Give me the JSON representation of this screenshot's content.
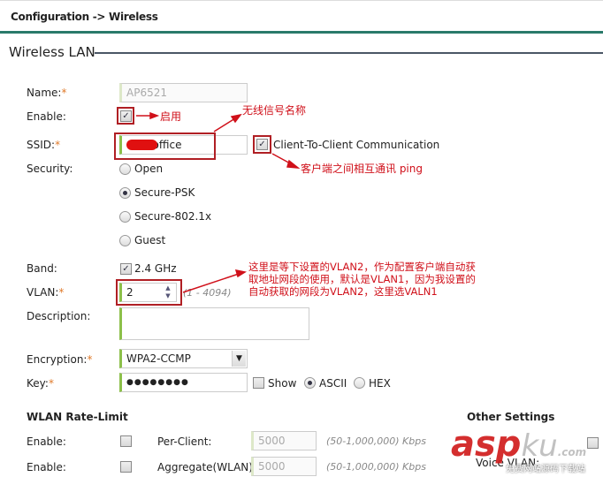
{
  "header": {
    "breadcrumb": "Configuration -> Wireless"
  },
  "section": {
    "title": "Wireless LAN"
  },
  "form": {
    "name_label": "Name:",
    "name_value": "AP6521",
    "enable_label": "Enable:",
    "ssid_label": "SSID:",
    "ssid_value": "-office",
    "c2c_label": "Client-To-Client Communication",
    "security_label": "Security:",
    "security_options": [
      "Open",
      "Secure-PSK",
      "Secure-802.1x",
      "Guest"
    ],
    "security_selected": "Secure-PSK",
    "band_label": "Band:",
    "band_value": "2.4 GHz",
    "vlan_label": "VLAN:",
    "vlan_value": "2",
    "vlan_hint": "(1 - 4094)",
    "description_label": "Description:",
    "encryption_label": "Encryption:",
    "encryption_value": "WPA2-CCMP",
    "key_label": "Key:",
    "key_value": "●●●●●●●●",
    "show_label": "Show",
    "ascii_label": "ASCII",
    "hex_label": "HEX"
  },
  "rate_limit": {
    "title": "WLAN Rate-Limit",
    "rows": [
      {
        "enable_label": "Enable:",
        "type_label": "Per-Client:",
        "value": "5000",
        "hint": "(50-1,000,000) Kbps"
      },
      {
        "enable_label": "Enable:",
        "type_label": "Aggregate(WLAN):",
        "value": "5000",
        "hint": "(50-1,000,000) Kbps"
      }
    ]
  },
  "other": {
    "title": "Other Settings",
    "voice_vlan_label": "Voice VLAN:"
  },
  "annotations": {
    "enable": "启用",
    "ssid": "无线信号名称",
    "c2c": "客户端之间相互通讯 ping",
    "vlan": [
      "这里是等下设置的VLAN2，作为配置客户端自动获",
      "取地址网段的使用，默认是VLAN1，因为我设置的",
      "自动获取的网段为VLAN2，这里选VALN1"
    ]
  },
  "watermark": {
    "text": "aspku.com",
    "sub": "免费网站源码下载站"
  },
  "colors": {
    "accent": "#2a7a6a",
    "annotation": "#d0101a",
    "required": "#e07a2a"
  }
}
